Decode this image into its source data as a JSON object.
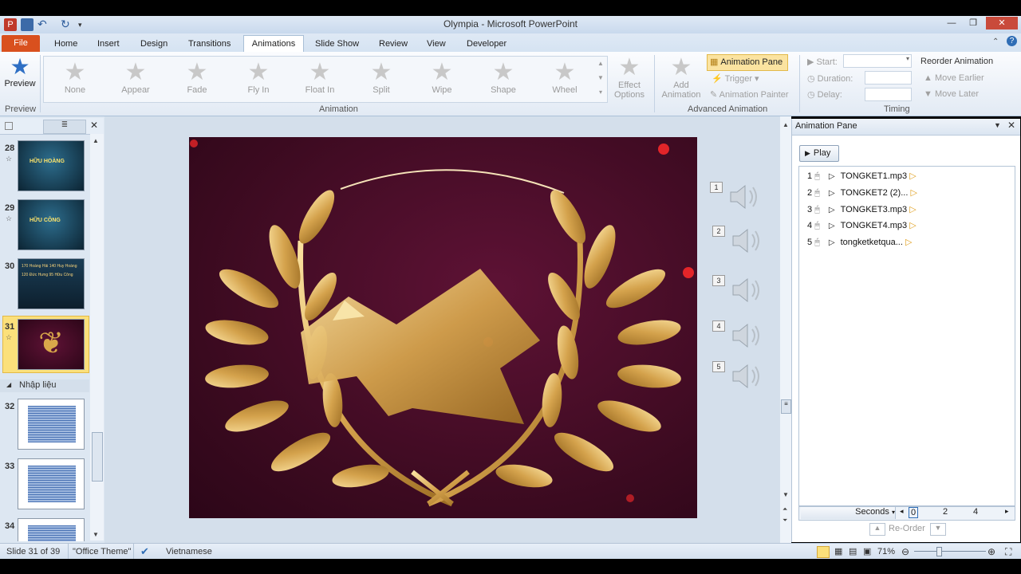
{
  "window": {
    "title": "Olympia - Microsoft PowerPoint"
  },
  "tabs": [
    "File",
    "Home",
    "Insert",
    "Design",
    "Transitions",
    "Animations",
    "Slide Show",
    "Review",
    "View",
    "Developer"
  ],
  "active_tab": "Animations",
  "ribbon": {
    "preview": {
      "label": "Preview",
      "group": "Preview"
    },
    "animation_group": "Animation",
    "animations": [
      "None",
      "Appear",
      "Fade",
      "Fly In",
      "Float In",
      "Split",
      "Wipe",
      "Shape",
      "Wheel"
    ],
    "effect_options": "Effect Options",
    "add_animation": "Add Animation",
    "animation_pane_btn": "Animation Pane",
    "trigger": "Trigger",
    "animation_painter": "Animation Painter",
    "advanced_group": "Advanced Animation",
    "start_label": "Start:",
    "duration_label": "Duration:",
    "delay_label": "Delay:",
    "reorder_title": "Reorder Animation",
    "move_earlier": "Move Earlier",
    "move_later": "Move Later",
    "timing_group": "Timing"
  },
  "slides_pane": {
    "slides": [
      {
        "num": "28",
        "text": "HỮU HOÀNG"
      },
      {
        "num": "29",
        "text": "HỮU CÔNG"
      },
      {
        "num": "30",
        "text": "170 Hoàng Hải 140 Huy Hoàng 120 Đức Hưng 95 Hữu Công"
      },
      {
        "num": "31",
        "text": ""
      },
      {
        "num": "32",
        "text": ""
      },
      {
        "num": "33",
        "text": ""
      },
      {
        "num": "34",
        "text": ""
      }
    ],
    "section_label": "Nhập liệu"
  },
  "slide": {
    "speakers": [
      "1",
      "2",
      "3",
      "4",
      "5"
    ]
  },
  "animation_pane": {
    "title": "Animation Pane",
    "play": "Play",
    "items": [
      {
        "num": "1",
        "name": "TONGKET1.mp3"
      },
      {
        "num": "2",
        "name": "TONGKET2 (2)..."
      },
      {
        "num": "3",
        "name": "TONGKET3.mp3"
      },
      {
        "num": "4",
        "name": "TONGKET4.mp3"
      },
      {
        "num": "5",
        "name": "tongketketqua..."
      }
    ],
    "seconds": "Seconds",
    "timeline": [
      "0",
      "2",
      "4"
    ],
    "reorder": "Re-Order"
  },
  "status": {
    "slide": "Slide 31 of 39",
    "theme": "\"Office Theme\"",
    "language": "Vietnamese",
    "zoom": "71%"
  },
  "colors": {
    "accent": "#d9501e",
    "ribbon": "#dfe9f5",
    "gold": "#e0b45a"
  }
}
